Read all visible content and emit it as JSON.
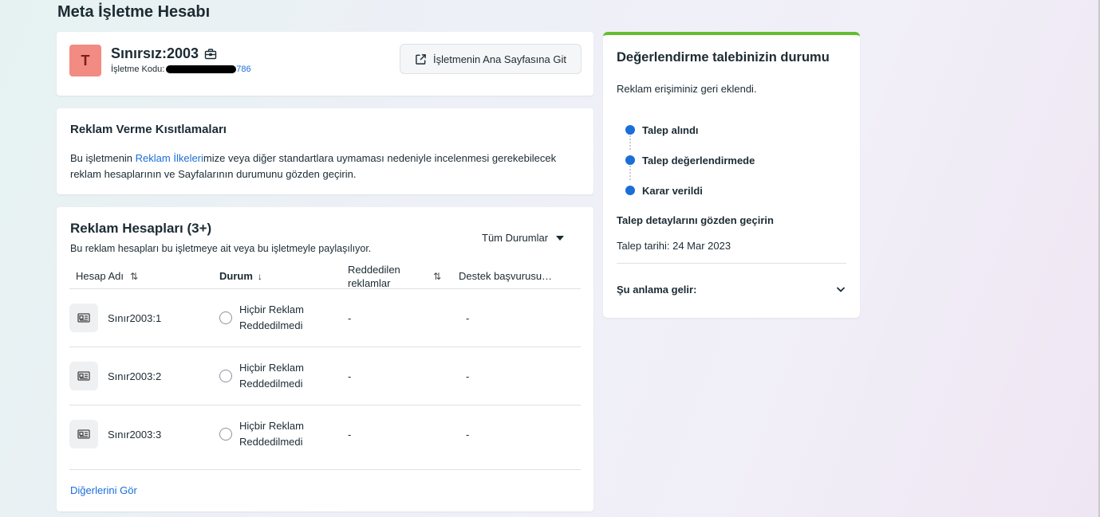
{
  "page": {
    "title": "Meta İşletme Hesabı"
  },
  "business": {
    "initial": "T",
    "name": "Sınırsız:2003",
    "code_label": "İşletme Kodu:",
    "code_tail": "786",
    "home_button": "İşletmenin Ana Sayfasına Git"
  },
  "restrictions": {
    "title": "Reklam Verme Kısıtlamaları",
    "text_before": "Bu işletmenin ",
    "link": "Reklam İlkeleri",
    "text_after": "mize veya diğer standartlara uymaması nedeniyle incelenmesi gerekebilecek reklam hesaplarının ve Sayfalarının durumunu gözden geçirin."
  },
  "accounts": {
    "title": "Reklam Hesapları (3+)",
    "subtitle": "Bu reklam hesapları bu işletmeye ait veya bu işletmeyle paylaşılıyor.",
    "filter": "Tüm Durumlar",
    "columns": {
      "name": "Hesap Adı",
      "status": "Durum",
      "rejected": "Reddedilen reklamlar",
      "support": "Destek başvurusu…"
    },
    "rows": [
      {
        "name": "Sınır2003:1",
        "status": "Hiçbir Reklam Reddedilmedi",
        "rejected": "-",
        "support": "-"
      },
      {
        "name": "Sınır2003:2",
        "status": "Hiçbir Reklam Reddedilmedi",
        "rejected": "-",
        "support": "-"
      },
      {
        "name": "Sınır2003:3",
        "status": "Hiçbir Reklam Reddedilmedi",
        "rejected": "-",
        "support": "-"
      }
    ],
    "see_more": "Diğerlerini Gör"
  },
  "evaluation": {
    "title": "Değerlendirme talebinizin durumu",
    "subtitle": "Reklam erişiminiz geri eklendi.",
    "steps": [
      "Talep alındı",
      "Talep değerlendirmede",
      "Karar verildi"
    ],
    "review_link": "Talep detaylarını gözden geçirin",
    "date": "Talep tarihi: 24 Mar 2023",
    "meaning": "Şu anlama gelir:"
  },
  "colors": {
    "accent": "#1a6ed8",
    "success_bar": "#63be2d",
    "avatar": "#f28b82"
  },
  "icons": [
    "briefcase-icon",
    "external-link-icon",
    "ad-account-icon",
    "chevron-down-icon",
    "sort-icon",
    "sort-down-icon"
  ]
}
